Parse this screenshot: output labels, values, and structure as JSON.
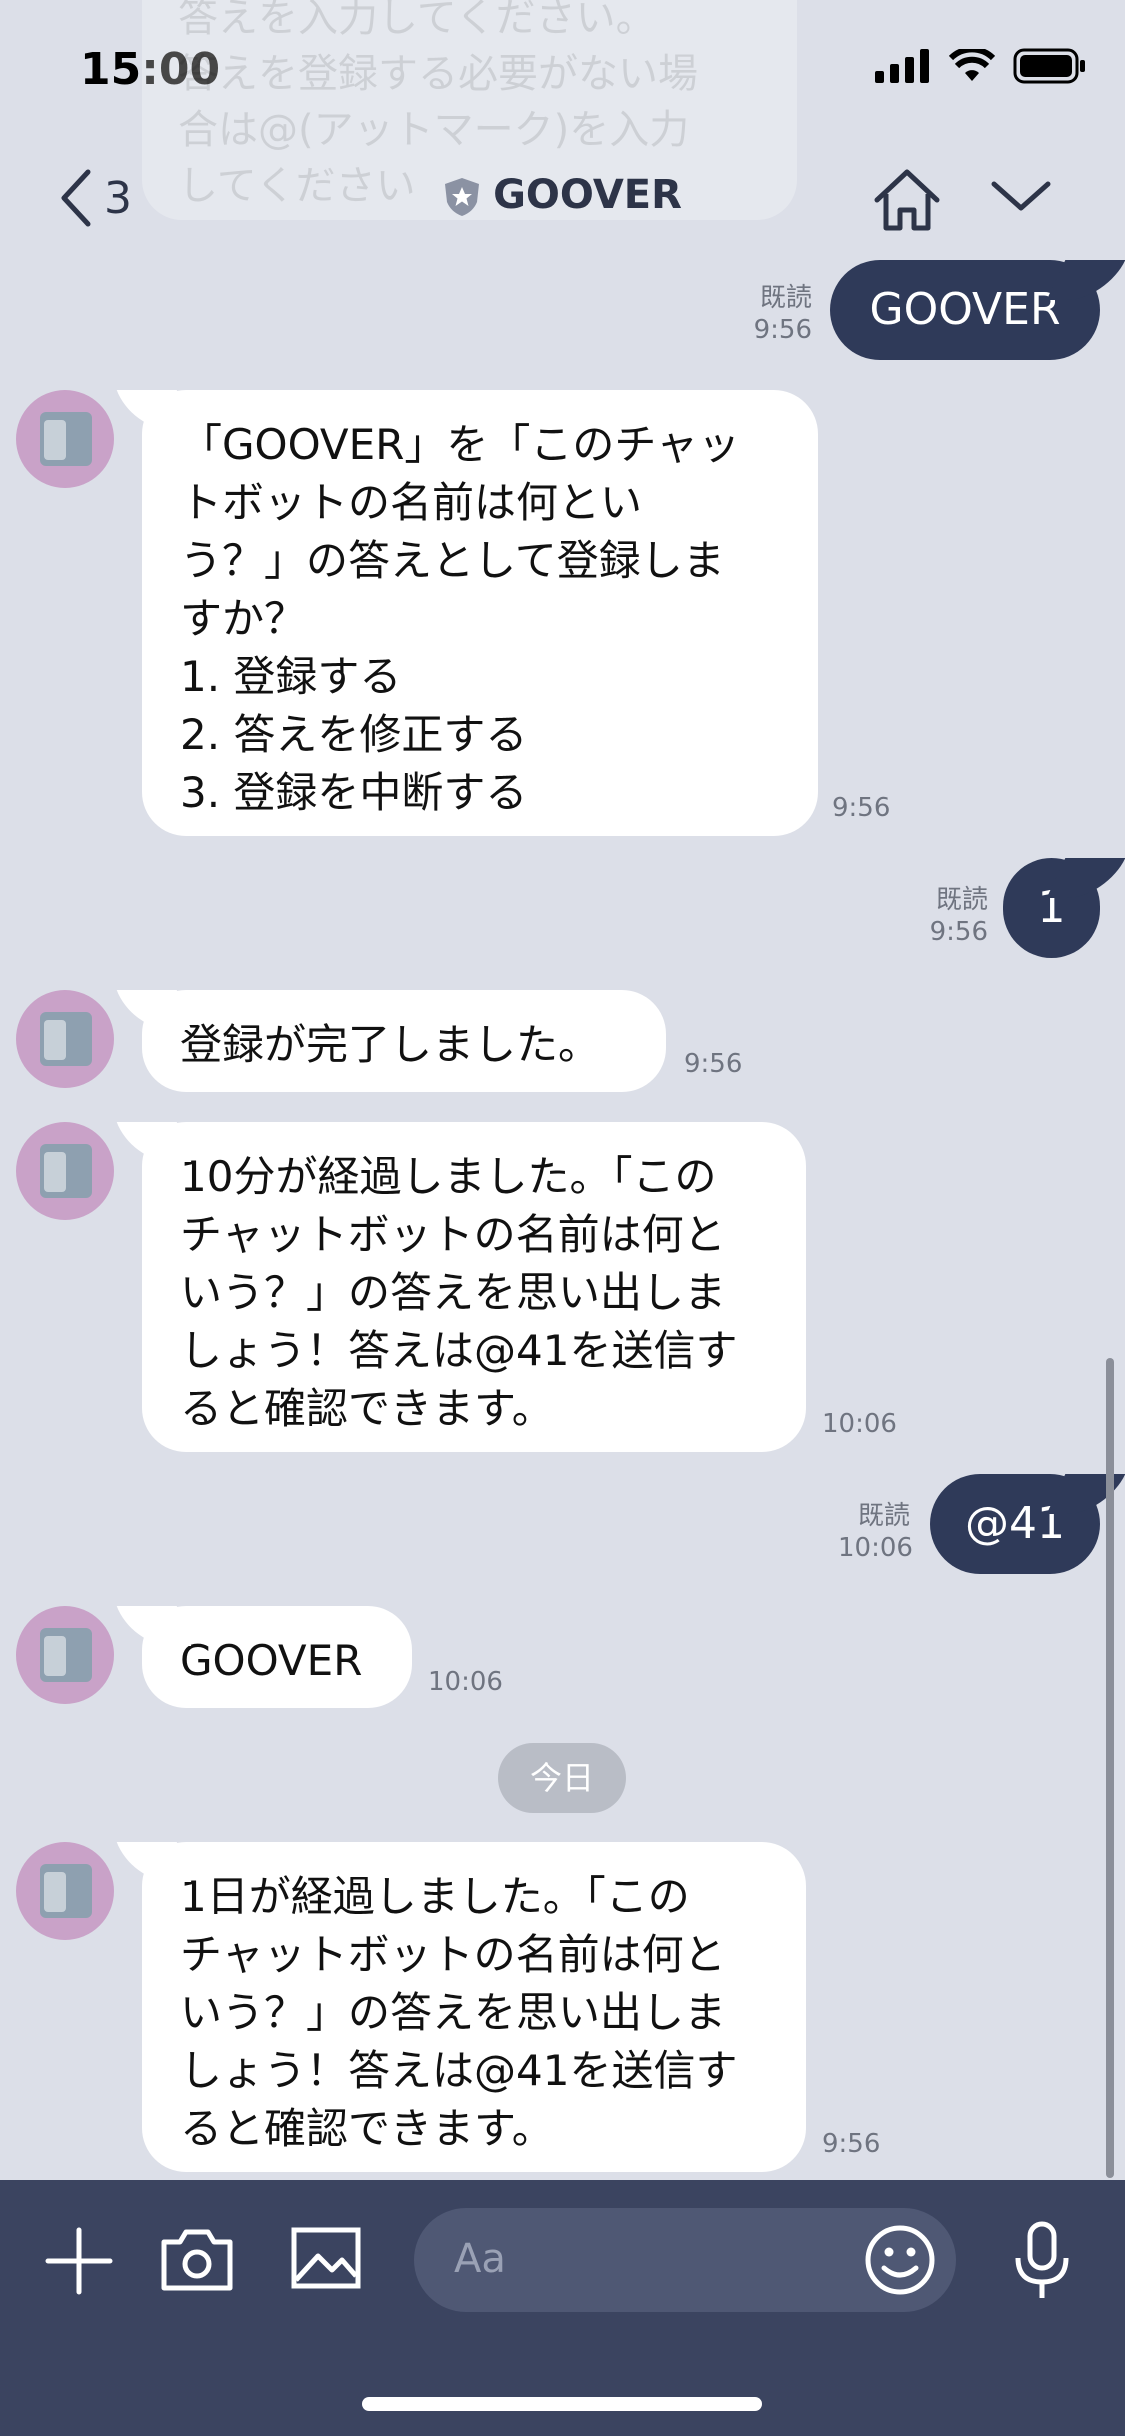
{
  "status_bar": {
    "time": "15:00"
  },
  "ghost_message": {
    "text": "答えを入力してください。\n答えを登録する必要がない場\n合は@(アットマーク)を入力\nしてください"
  },
  "header": {
    "back_count": "3",
    "title": "GOOVER"
  },
  "messages": [
    {
      "dir": "out",
      "text": "GOOVER",
      "read": "既読",
      "time": "9:56"
    },
    {
      "dir": "in",
      "text": "「GOOVER」を「このチャッ\nトボットの名前は何とい\nう？」の答えとして登録しま\nすか？\n1. 登録する\n2. 答えを修正する\n3. 登録を中断する",
      "time": "9:56"
    },
    {
      "dir": "out",
      "text": "1",
      "read": "既読",
      "time": "9:56"
    },
    {
      "dir": "in",
      "text": "登録が完了しました。",
      "time": "9:56"
    },
    {
      "dir": "in",
      "text": "10分が経過しました。「この\nチャットボットの名前は何と\nいう？」の答えを思い出しま\nしょう！答えは@41を送信す\nると確認できます。",
      "time": "10:06"
    },
    {
      "dir": "out",
      "text": "@41",
      "read": "既読",
      "time": "10:06"
    },
    {
      "dir": "in",
      "text": "GOOVER",
      "time": "10:06"
    },
    {
      "dir": "in",
      "text": "1日が経過しました。「この\nチャットボットの名前は何と\nいう？」の答えを思い出しま\nしょう！答えは@41を送信す\nると確認できます。",
      "time": "9:56"
    }
  ],
  "date_divider": "今日",
  "input": {
    "placeholder": "Aa"
  },
  "colors": {
    "background": "#dcdfe8",
    "out_bubble": "#2f3a59",
    "in_bubble": "#ffffff",
    "input_bar": "#3b4460"
  }
}
